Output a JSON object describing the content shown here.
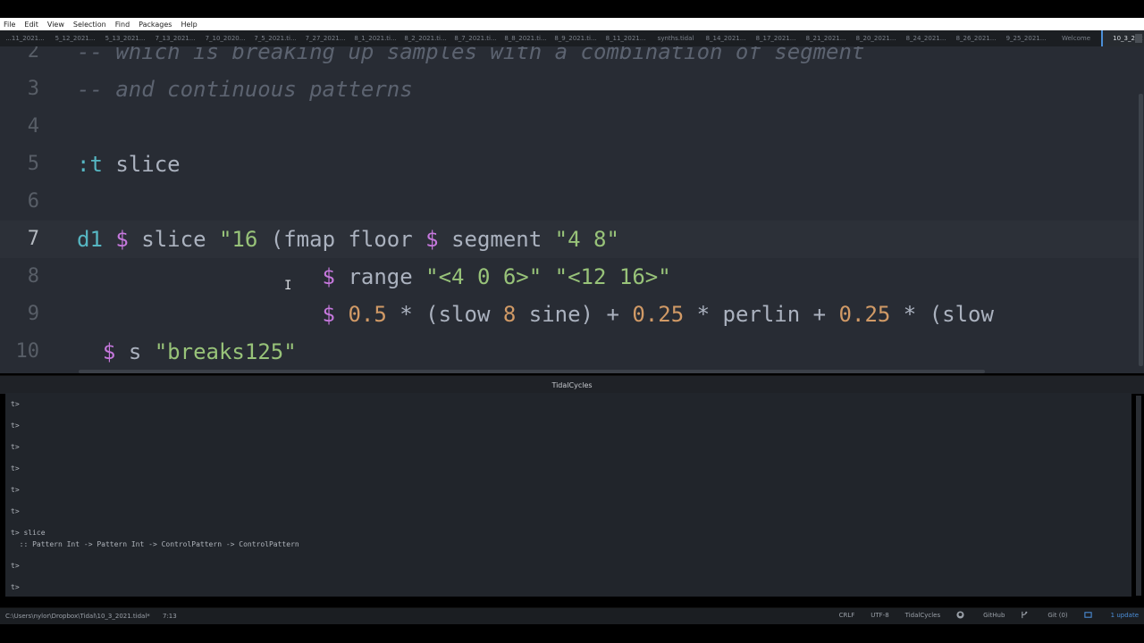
{
  "menu": [
    "File",
    "Edit",
    "View",
    "Selection",
    "Find",
    "Packages",
    "Help"
  ],
  "tabs": [
    "...11_2021...",
    "5_12_2021...",
    "5_13_2021...",
    "7_13_2021...",
    "7_10_2020...",
    "7_5_2021.ti...",
    "7_27_2021...",
    "8_1_2021.ti...",
    "8_2_2021.ti...",
    "8_7_2021.ti...",
    "8_8_2021.ti...",
    "8_9_2021.ti...",
    "8_11_2021...",
    "synths.tidal",
    "8_14_2021...",
    "8_17_2021...",
    "8_21_2021...",
    "8_20_2021...",
    "8_24_2021...",
    "8_26_2021...",
    "9_25_2021...",
    "Welcome",
    "10_3_202"
  ],
  "active_tab_index": 22,
  "editor": {
    "lines": [
      {
        "num": "2",
        "tokens": [
          {
            "t": "-- which is breaking up samples with a combination of segment",
            "c": "comment"
          }
        ]
      },
      {
        "num": "3",
        "tokens": [
          {
            "t": "-- and continuous patterns",
            "c": "comment"
          }
        ]
      },
      {
        "num": "4",
        "tokens": []
      },
      {
        "num": "5",
        "tokens": [
          {
            "t": ":t ",
            "c": "kw"
          },
          {
            "t": "slice",
            "c": "plain"
          }
        ]
      },
      {
        "num": "6",
        "tokens": []
      },
      {
        "num": "7",
        "tokens": [
          {
            "t": "d1 ",
            "c": "kw"
          },
          {
            "t": "$ ",
            "c": "dollar"
          },
          {
            "t": "slice ",
            "c": "plain"
          },
          {
            "t": "\"16 ",
            "c": "str"
          },
          {
            "t": "(fmap floor ",
            "c": "plain"
          },
          {
            "t": "$ ",
            "c": "dollar"
          },
          {
            "t": "segment ",
            "c": "plain"
          },
          {
            "t": "\"4 8\"",
            "c": "str"
          }
        ]
      },
      {
        "num": "8",
        "tokens": [
          {
            "t": "                   ",
            "c": "plain"
          },
          {
            "t": "$ ",
            "c": "dollar"
          },
          {
            "t": "range ",
            "c": "plain"
          },
          {
            "t": "\"<4 0 6>\" \"<12 16>\"",
            "c": "str"
          }
        ]
      },
      {
        "num": "9",
        "tokens": [
          {
            "t": "                   ",
            "c": "plain"
          },
          {
            "t": "$ ",
            "c": "dollar"
          },
          {
            "t": "0.5 ",
            "c": "num"
          },
          {
            "t": "* (slow ",
            "c": "plain"
          },
          {
            "t": "8 ",
            "c": "num"
          },
          {
            "t": "sine) + ",
            "c": "plain"
          },
          {
            "t": "0.25 ",
            "c": "num"
          },
          {
            "t": "* perlin + ",
            "c": "plain"
          },
          {
            "t": "0.25 ",
            "c": "num"
          },
          {
            "t": "* (slow",
            "c": "plain"
          }
        ]
      },
      {
        "num": "10",
        "tokens": [
          {
            "t": "  ",
            "c": "plain"
          },
          {
            "t": "$ ",
            "c": "dollar"
          },
          {
            "t": "s ",
            "c": "plain"
          },
          {
            "t": "\"breaks125\"",
            "c": "str"
          }
        ]
      }
    ],
    "current_line": "7"
  },
  "panel": {
    "title": "TidalCycles"
  },
  "console": [
    "t>",
    "t>",
    "t>",
    "t>",
    "t>",
    "t>",
    "t> slice",
    "  :: Pattern Int -> Pattern Int -> ControlPattern -> ControlPattern",
    "t>",
    "t>"
  ],
  "status": {
    "path": "C:\\Users\\nylor\\Dropbox\\Tidal\\10_3_2021.tidal*",
    "position": "7:13",
    "line_ending": "CRLF",
    "encoding": "UTF-8",
    "grammar": "TidalCycles",
    "github": "GitHub",
    "git": "Git (0)",
    "updates": "1 update"
  },
  "colors": {
    "editor_bg": "#282c34",
    "accent": "#4b8ed8",
    "string": "#98c379",
    "keyword": "#56b6c2",
    "number": "#d19a66",
    "comment": "#5c6370"
  }
}
